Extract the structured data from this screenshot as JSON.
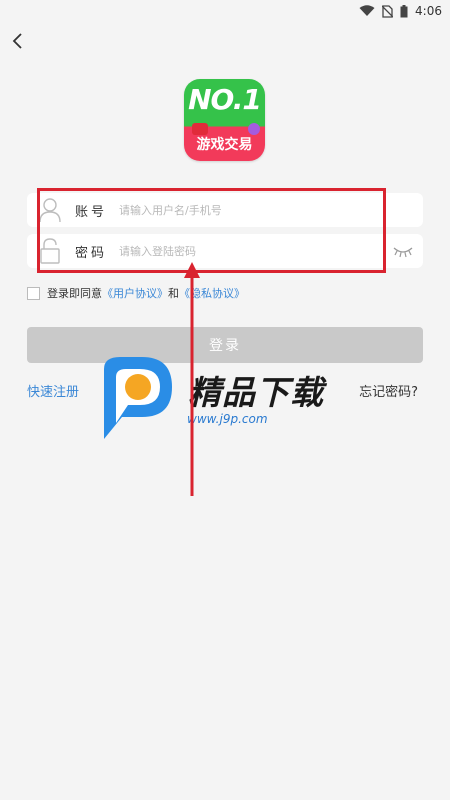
{
  "status_bar": {
    "time": "4:06",
    "icons": [
      "wifi-icon",
      "no-sim-icon",
      "battery-icon"
    ]
  },
  "header": {
    "back_icon": "chevron-left-icon"
  },
  "logo": {
    "top_text": "NO.1",
    "bottom_text": "游戏交易"
  },
  "form": {
    "account": {
      "label": "账号",
      "placeholder": "请输入用户名/手机号",
      "value": "",
      "icon": "user-icon"
    },
    "password": {
      "label": "密码",
      "placeholder": "请输入登陆密码",
      "value": "",
      "icon": "lock-icon",
      "toggle_icon": "eye-closed-icon"
    }
  },
  "agreement": {
    "checked": false,
    "prefix": "登录即同意",
    "user_agreement": "《用户协议》",
    "and": "和",
    "privacy_agreement": "《隐私协议》"
  },
  "actions": {
    "login_label": "登录",
    "quick_register": "快速注册",
    "forgot_password": "忘记密码?"
  },
  "watermark": {
    "title": "精品下载",
    "url": "www.j9p.com"
  },
  "colors": {
    "link": "#3a87d6",
    "highlight": "#d9232f",
    "button_disabled": "#c9c9c9",
    "background": "#f4f4f4"
  }
}
